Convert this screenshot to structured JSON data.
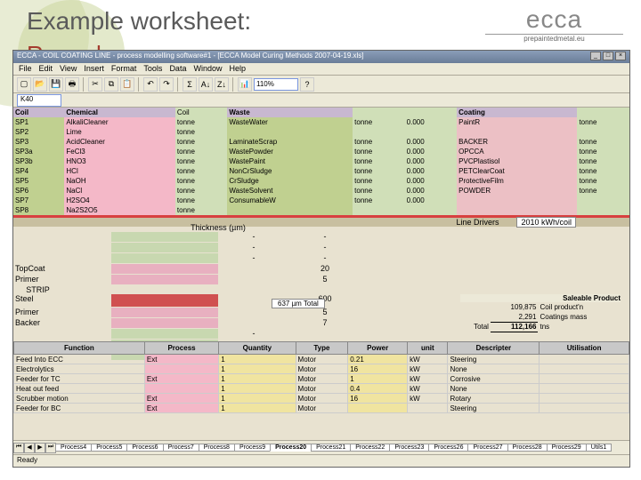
{
  "slide": {
    "title": "Example worksheet:",
    "subtitle": "Record"
  },
  "logo": {
    "brand": "ecca",
    "tagline": "prepaintedmetal.eu"
  },
  "window": {
    "title": "ECCA - COIL COATING LINE - process modelling software#1 - [ECCA Model Curing Methods 2007-04-19.xls]",
    "menu": [
      "File",
      "Edit",
      "View",
      "Insert",
      "Format",
      "Tools",
      "Data",
      "Window",
      "Help"
    ],
    "zoom": "110%",
    "cellref": "K40",
    "status": "Ready"
  },
  "top_table": {
    "col1": {
      "head": "Coil",
      "rows": [
        "SP1",
        "SP2",
        "SP3",
        "SP3a",
        "SP3b",
        "SP4",
        "SP5",
        "SP6",
        "SP7",
        "SP8"
      ]
    },
    "col2": {
      "head": "Chemical",
      "rows": [
        "AlkaliCleaner",
        "Lime",
        "AcidCleaner",
        "FeCl3",
        "HNO3",
        "HCl",
        "NaOH",
        "NaCl",
        "H2SO4",
        "Na2S2O5"
      ]
    },
    "col3": {
      "head": "Coil",
      "rows": [
        "tonne",
        "tonne",
        "tonne",
        "tonne",
        "tonne",
        "tonne",
        "tonne",
        "tonne",
        "tonne",
        "tonne"
      ]
    },
    "col4": {
      "head": "Waste",
      "rows": [
        "WasteWater",
        "",
        "LaminateScrap",
        "WastePowder",
        "WastePaint",
        "NonCrSludge",
        "CrSludge",
        "WasteSolvent",
        "ConsumableW"
      ]
    },
    "col5": {
      "head": "",
      "rows": [
        "tonne",
        "",
        "tonne",
        "tonne",
        "tonne",
        "tonne",
        "tonne",
        "tonne",
        "tonne"
      ]
    },
    "col6": {
      "head": "",
      "rows": [
        "0.000",
        "",
        "0.000",
        "0.000",
        "0.000",
        "0.000",
        "0.000",
        "0.000",
        "0.000"
      ]
    },
    "col7": {
      "head": "Coating",
      "rows": [
        "PaintR",
        "",
        "BACKER",
        "OPCCA",
        "PVCPlastisol",
        "PETClearCoat",
        "ProtectiveFilm",
        "POWDER"
      ]
    },
    "col8": {
      "head": "",
      "rows": [
        "tonne",
        "",
        "tonne",
        "tonne",
        "tonne",
        "tonne",
        "tonne",
        "tonne"
      ]
    },
    "line_drivers": "Line Drivers",
    "line_drivers_val": "2010 kWh/coil"
  },
  "thickness": {
    "title": "Thickness (µm)",
    "rows": [
      {
        "label": "",
        "a": "-",
        "b": "-"
      },
      {
        "label": "",
        "a": "-",
        "b": "-"
      },
      {
        "label": "",
        "a": "-",
        "b": "-"
      },
      {
        "label": "TopCoat",
        "a": "",
        "b": "20"
      },
      {
        "label": "Primer",
        "a": "",
        "b": "5"
      },
      {
        "label": "Steel",
        "a": "",
        "b": "600"
      },
      {
        "label": "Primer",
        "a": "",
        "b": "5"
      },
      {
        "label": "Backer",
        "a": "",
        "b": "7"
      },
      {
        "label": "",
        "a": "-",
        "b": ""
      },
      {
        "label": "",
        "a": "-",
        "b": ""
      },
      {
        "label": "",
        "a": "-",
        "b": ""
      }
    ],
    "strip_label": "STRIP",
    "total_label": "637 µm Total"
  },
  "saleable": {
    "head": "Saleable Product",
    "rows": [
      {
        "v": "109,875",
        "d": "Coil product'n"
      },
      {
        "v": "2,291",
        "d": "Coatings mass"
      },
      {
        "v": "112,166",
        "d": "tns"
      }
    ],
    "total_label": "Total"
  },
  "func_table": {
    "headers": [
      "Function",
      "Process",
      "Quantity",
      "Type",
      "Power",
      "unit",
      "Descripter",
      "Utilisation"
    ],
    "rows": [
      {
        "f": "Feed Into ECC",
        "p": "Ext",
        "q": "1",
        "t": "Motor",
        "pw": "0.21",
        "u": "kW",
        "d": "Steering",
        "ut": ""
      },
      {
        "f": "Electrolytics",
        "p": "",
        "q": "1",
        "t": "Motor",
        "pw": "16",
        "u": "kW",
        "d": "None",
        "ut": ""
      },
      {
        "f": "Feeder for TC",
        "p": "Ext",
        "q": "1",
        "t": "Motor",
        "pw": "1",
        "u": "kW",
        "d": "Corrosive",
        "ut": ""
      },
      {
        "f": "Heat out feed",
        "p": "",
        "q": "1",
        "t": "Motor",
        "pw": "0.4",
        "u": "kW",
        "d": "None",
        "ut": ""
      },
      {
        "f": "Scrubber motion",
        "p": "Ext",
        "q": "1",
        "t": "Motor",
        "pw": "16",
        "u": "kW",
        "d": "Rotary",
        "ut": ""
      },
      {
        "f": "Feeder for BC",
        "p": "Ext",
        "q": "1",
        "t": "Motor",
        "pw": "",
        "u": "",
        "d": "Steering",
        "ut": ""
      }
    ]
  },
  "sheets": [
    "Process4",
    "Process5",
    "Process6",
    "Process7",
    "Process8",
    "Process9",
    "Process20",
    "Process21",
    "Process22",
    "Process23",
    "Process26",
    "Process27",
    "Process28",
    "Process29",
    "Utils1"
  ],
  "active_sheet": "Process20"
}
